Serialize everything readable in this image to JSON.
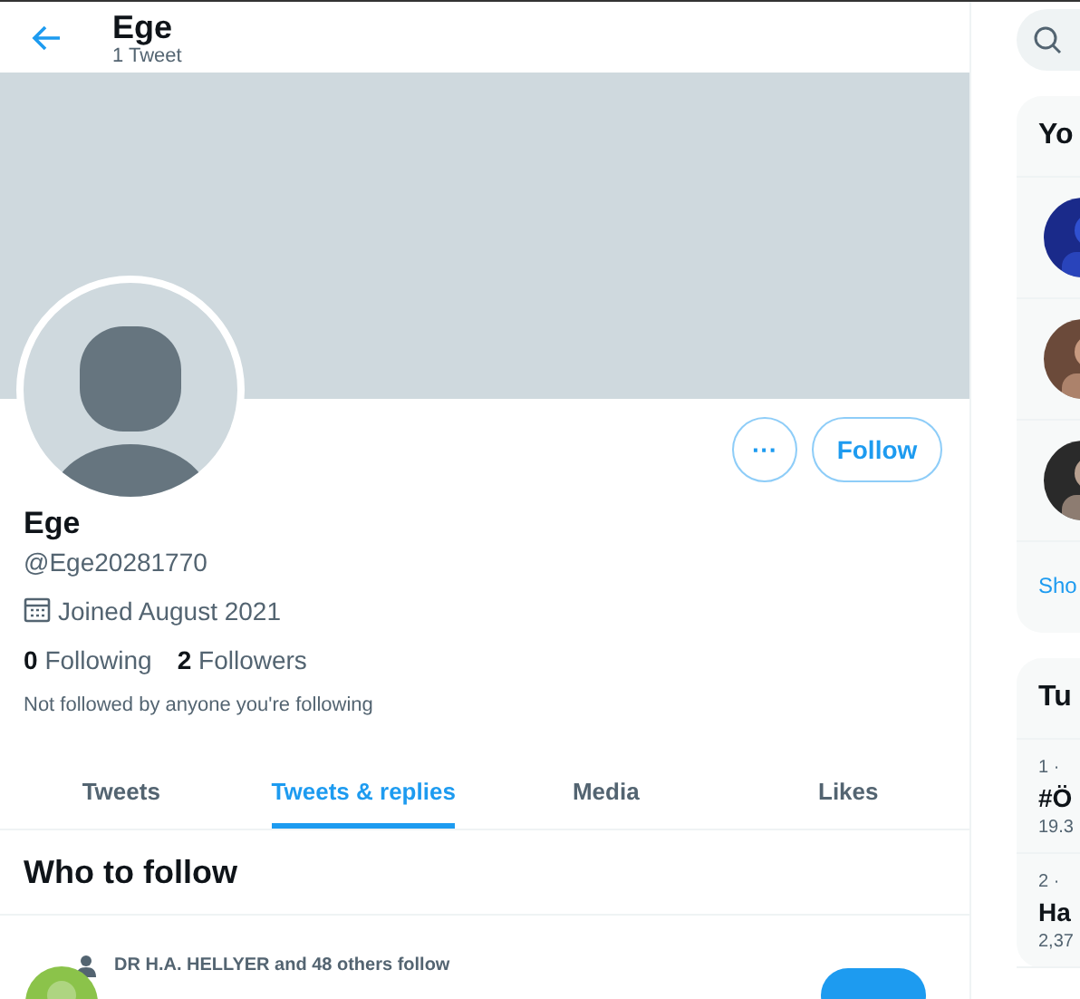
{
  "header": {
    "title": "Ege",
    "subtitle": "1 Tweet"
  },
  "profile": {
    "name": "Ege",
    "handle": "@Ege20281770",
    "joined": "Joined August 2021",
    "following_count": "0",
    "following_label": "Following",
    "followers_count": "2",
    "followers_label": "Followers",
    "note": "Not followed by anyone you're following",
    "more_button": "···",
    "follow_button": "Follow"
  },
  "tabs": [
    {
      "label": "Tweets",
      "selected": false
    },
    {
      "label": "Tweets & replies",
      "selected": true
    },
    {
      "label": "Media",
      "selected": false
    },
    {
      "label": "Likes",
      "selected": false
    }
  ],
  "who_to_follow": {
    "title": "Who to follow",
    "context": "DR H.A. HELLYER and 48 others follow"
  },
  "sidebar": {
    "you_might_like": {
      "title": "Yo",
      "show_more": "Sho"
    },
    "trends": {
      "title": "Tu",
      "items": [
        {
          "meta": "1 ·",
          "name": "#Ö",
          "count": "19.3"
        },
        {
          "meta": "2 ·",
          "name": "Ha",
          "count": "2,37"
        }
      ]
    }
  }
}
